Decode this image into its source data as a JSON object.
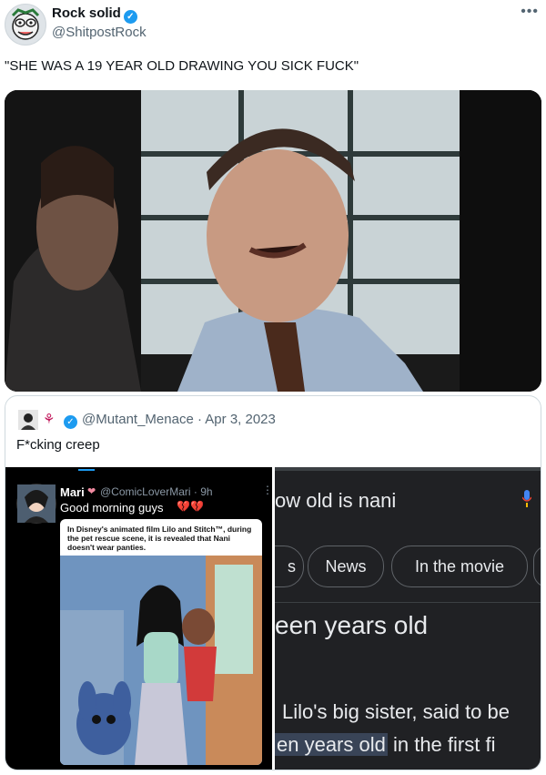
{
  "tweet": {
    "author_name": "Rock solid",
    "author_handle": "@ShitpostRock",
    "text": "\"SHE WAS A 19 YEAR OLD DRAWING YOU SICK FUCK\""
  },
  "icons": {
    "verified": "verified-badge-icon",
    "more": "more-options-icon",
    "mic": "microphone-icon"
  },
  "quote": {
    "handle": "@Mutant_Menace",
    "date": "· Apr 3, 2023",
    "text": "F*cking creep"
  },
  "left_screenshot": {
    "name": "Mari",
    "handle": "@ComicLoverMari · 9h",
    "text": "Good morning guys",
    "caption": "In Disney's animated film Lilo and Stitch™, during the pet rescue scene, it is revealed that Nani doesn't wear panties."
  },
  "right_screenshot": {
    "query": "ow old is nani",
    "chips": [
      "s",
      "News",
      "In the movie"
    ],
    "answer": "een years old",
    "line1": "Lilo's big sister, said to be",
    "line2_highlight": "en years old",
    "line2_rest": " in the first fi"
  },
  "colors": {
    "accent": "#1d9bf0",
    "dark_bg": "#202124",
    "highlight": "#394457"
  }
}
